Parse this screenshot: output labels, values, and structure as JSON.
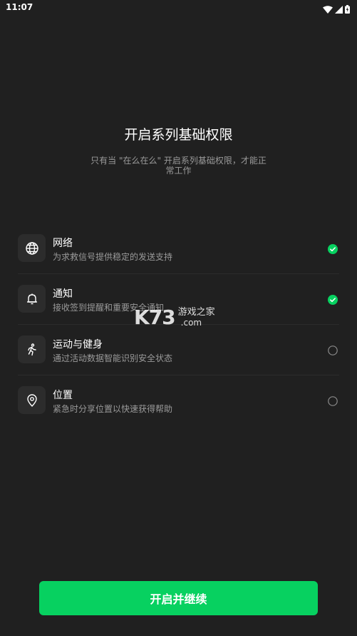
{
  "status_bar": {
    "time": "11:07",
    "icons": [
      "wifi-icon",
      "signal-icon",
      "battery-icon"
    ]
  },
  "title": "开启系列基础权限",
  "subtitle": "只有当 \"在么在么\" 开启系列基础权限，才能正常工作",
  "permissions": [
    {
      "icon": "globe-icon",
      "title": "网络",
      "desc": "为求救信号提供稳定的发送支持",
      "granted": true
    },
    {
      "icon": "bell-icon",
      "title": "通知",
      "desc": "接收签到提醒和重要安全通知",
      "granted": true
    },
    {
      "icon": "running-person-icon",
      "title": "运动与健身",
      "desc": "通过活动数据智能识别安全状态",
      "granted": false
    },
    {
      "icon": "location-pin-icon",
      "title": "位置",
      "desc": "紧急时分享位置以快速获得帮助",
      "granted": false
    }
  ],
  "watermark": {
    "logo": "K73",
    "name": "游戏之家",
    "domain": ".com"
  },
  "continue_button": {
    "label": "开启并继续"
  },
  "colors": {
    "background": "#202020",
    "accent_green": "#07d160",
    "icon_box": "#2c2c2c",
    "secondary_text": "#9a9a9a"
  }
}
